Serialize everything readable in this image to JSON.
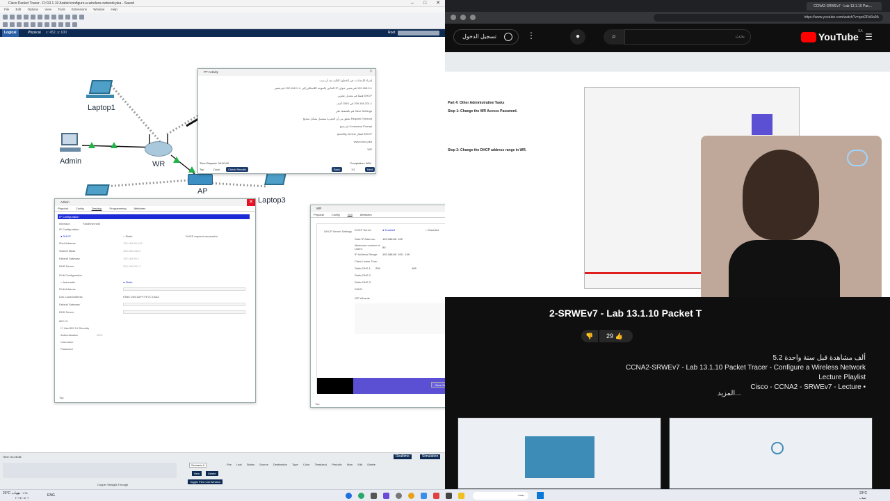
{
  "pt": {
    "title": "Cisco Packet Tracer - D:\\13.1.10 Arabic\\configure-a-wireless-network.pka - Saved",
    "menu": [
      "File",
      "Edit",
      "Options",
      "View",
      "Tools",
      "Extensions",
      "Window",
      "Help"
    ],
    "nav_logical": "Logical",
    "nav_physical": "Physical",
    "nav_coords": "x: 452, y: 630",
    "nav_root": "Root",
    "devices": {
      "laptop1": "Laptop1",
      "admin": "Admin",
      "wr": "WR",
      "ap": "AP",
      "laptop3": "Laptop3"
    },
    "time": "Time: 01:28:48",
    "realtime": "Realtime",
    "simulation": "Simulation",
    "scenario": "Scenario 0",
    "new": "New",
    "delete": "Delete",
    "toggle_pdu": "Toggle PDU List Window",
    "pdu_cols": [
      "Fire",
      "Last Status",
      "Source",
      "Destination",
      "Type",
      "Color",
      "Time(sec)",
      "Periodic",
      "Num",
      "Edit",
      "Delete"
    ],
    "cable": "Copper Straight-Through"
  },
  "activity": {
    "title": "PT Activity",
    "lines": [
      "إجراء الإعدادات في الخطوة التالية بعد أن تمت",
      "192.168.0.1 قم بتغيير عنوان IP الخاص بالموجه اللاسلكي إلى ،192.168.1.1 قم بتغيير",
      "DHCP فضلا قم بتعديل عناوين",
      "209.165.201.1 في DNS أضف",
      "Save Settings قم بالضغط على",
      "Request Timeout تحقق من أن التجربة ستعمل بشكل صحيح",
      "Command Prompt قم بفتح",
      "DHCP اتصال ipconfig /renew",
      "www.cisco.pka",
      "WR"
    ],
    "elapsed": "Time Elapsed: 00:00:00",
    "completion": "Completion: 96%",
    "top": "Top",
    "dock": "Dock",
    "check": "Check Results",
    "back": "Back",
    "page": "1/1",
    "next": "Next"
  },
  "admin": {
    "title": "Admin",
    "tabs": [
      "Physical",
      "Config",
      "Desktop",
      "Programming",
      "Attributes"
    ],
    "header": "IP Configuration",
    "interface_label": "Interface",
    "interface_value": "FastEthernet0",
    "ipconfig": "IP Configuration",
    "dhcp": "DHCP",
    "static": "Static",
    "dhcp_status": "DHCP request successful.",
    "fields": [
      {
        "label": "IPv4 Address",
        "value": "192.168.50.100"
      },
      {
        "label": "Subnet Mask",
        "value": "255.255.255.0"
      },
      {
        "label": "Default Gateway",
        "value": "192.168.50.1"
      },
      {
        "label": "DNS Server",
        "value": "209.165.201.1"
      }
    ],
    "ipv6_config": "IPv6 Configuration",
    "automatic": "Automatic",
    "ipv6_static": "Static",
    "ipv6_fields": [
      {
        "label": "IPv6 Address",
        "value": ""
      },
      {
        "label": "Link Local Address",
        "value": "FE80::206:2AFF:FE7C:C6A4"
      },
      {
        "label": "Default Gateway",
        "value": ""
      },
      {
        "label": "DNS Server",
        "value": ""
      }
    ],
    "dot1x": "802.1X",
    "use_dot1x": "Use 802.1X Security",
    "auth": "Authentication",
    "auth_value": "MD5",
    "username": "Username",
    "password": "Password",
    "top": "Top"
  },
  "wr": {
    "title": "WR",
    "tabs": [
      "Physical",
      "Config",
      "GUI",
      "Attributes"
    ],
    "dhcp_server_label": "DHCP Server Settings",
    "dhcp_server": "DHCP Server",
    "enabled": "Enabled",
    "disabled": "Disabled",
    "reservation": "DHCP Reservation",
    "start_ip": "Start IP Address:",
    "start_ip_val": "192.168.50. 100",
    "max_users": "Maximum number of Users:",
    "max_users_val": "50",
    "range": "IP Address Range:",
    "range_val": "192.168.50. 100 - 149",
    "lease": "Client Lease Time:",
    "lease_note": "minutes (0 means one day)",
    "dns1": "Static DNS 1:",
    "dns1_vals": [
      "209",
      "165",
      "201",
      "1"
    ],
    "dns2": "Static DNS 2:",
    "dns3": "Static DNS 3:",
    "wins": "WINS:",
    "isp": "ISP Wizards",
    "save": "Save Settings",
    "cancel": "Cancel Changes",
    "top": "Top"
  },
  "yt": {
    "url": "https://www.youtube.com/watch?v=qed2Rd3a9A",
    "tab_title": "CCNA2-SRWEv7 - Lab 13.1.10 Pac...",
    "signin": "تسجيل الدخول",
    "search_placeholder": "بحث",
    "logo": "YouTube",
    "logo_sup": "SA",
    "video_overlay_title": "2-SRWEv7 - Lab 13.1.10 Packet T",
    "likes": "29",
    "stats": "5.2 ألف مشاهدة  قبل سنة واحدة",
    "desc1": "CCNA2-SRWEv7 - Lab 13.1.10 Packet Tracer - Configure a Wireless Network",
    "desc2": "Lecture Playlist",
    "channel": "Cisco - CCNA2 - SRWEv7 - Lecture •",
    "more": "المزيد...",
    "inner_sections": [
      "Part 4: Other Administrative Tasks",
      "Step 1: Change the WR Access Password.",
      "Step 2: Change the DHCP address range in WR."
    ]
  },
  "taskbar": {
    "weather": "ضباب",
    "temp": "23°C",
    "lang": "ENG",
    "time": "٠١:٢٨ ص",
    "date": "٢٠٢٤/٠٨/٠٦",
    "search": "بحث"
  }
}
